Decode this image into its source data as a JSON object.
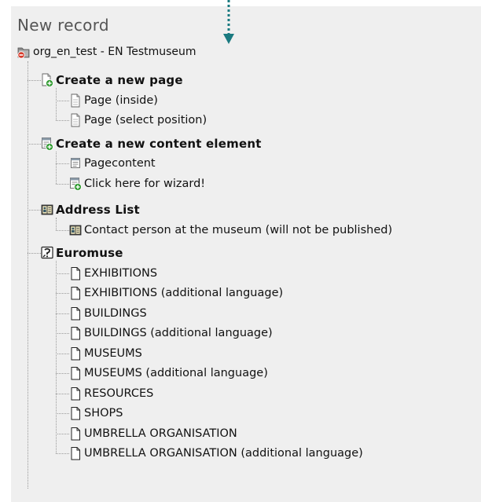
{
  "title": "New record",
  "root": {
    "label": "org_en_test - EN Testmuseum",
    "icon": "folder-locked-icon"
  },
  "sections": [
    {
      "id": "page",
      "label": "Create a new page",
      "icon": "new-page-icon",
      "items": [
        {
          "label": "Page (inside)",
          "icon": "page-icon"
        },
        {
          "label": "Page (select position)",
          "icon": "page-icon"
        }
      ]
    },
    {
      "id": "content",
      "label": "Create a new content element",
      "icon": "new-content-element-icon",
      "items": [
        {
          "label": "Pagecontent",
          "icon": "content-element-icon"
        },
        {
          "label": "Click here for wizard!",
          "icon": "wizard-icon"
        }
      ]
    },
    {
      "id": "address",
      "label": "Address List",
      "icon": "address-book-icon",
      "items": [
        {
          "label": "Contact person at the museum (will not be published)",
          "icon": "address-book-icon"
        }
      ]
    },
    {
      "id": "euromuse",
      "label": "Euromuse",
      "icon": "euromuse-icon",
      "items": [
        {
          "label": "EXHIBITIONS",
          "icon": "document-icon"
        },
        {
          "label": "EXHIBITIONS (additional language)",
          "icon": "document-icon"
        },
        {
          "label": "BUILDINGS",
          "icon": "document-icon"
        },
        {
          "label": "BUILDINGS (additional language)",
          "icon": "document-icon"
        },
        {
          "label": "MUSEUMS",
          "icon": "document-icon"
        },
        {
          "label": "MUSEUMS (additional language)",
          "icon": "document-icon"
        },
        {
          "label": "RESOURCES",
          "icon": "document-icon"
        },
        {
          "label": "SHOPS",
          "icon": "document-icon"
        },
        {
          "label": "UMBRELLA ORGANISATION",
          "icon": "document-icon"
        },
        {
          "label": "UMBRELLA ORGANISATION (additional language)",
          "icon": "document-icon"
        }
      ]
    }
  ],
  "colors": {
    "panel": "#efefef",
    "arrow": "#1a7a80",
    "add_badge": "#2e9a2e",
    "lock_badge": "#d63a2a"
  }
}
